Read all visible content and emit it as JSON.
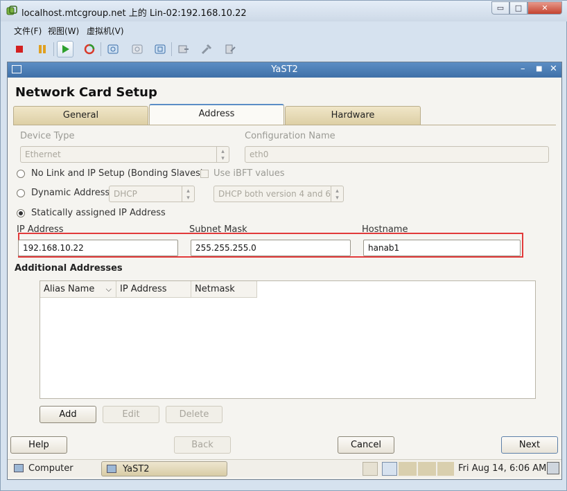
{
  "vm": {
    "title": "localhost.mtcgroup.net 上的 Lin-02:192.168.10.22",
    "menus": [
      "文件(F)",
      "视图(W)",
      "虚拟机(V)"
    ],
    "toolbar_icons": [
      "stop-icon",
      "pause-icon",
      "play-icon",
      "refresh-icon",
      "snapshot-icon",
      "snapshot-revert-icon",
      "snapshot-manager-icon",
      "migrate-icon",
      "tools-icon",
      "settings-icon"
    ],
    "window_controls": {
      "minimize": "▭",
      "maximize": "□",
      "close": "✕"
    }
  },
  "yast": {
    "window_title": "YaST2",
    "heading": "Network Card Setup",
    "tabs": [
      {
        "label": "General",
        "active": false
      },
      {
        "label": "Address",
        "active": true
      },
      {
        "label": "Hardware",
        "active": false
      }
    ],
    "device_type": {
      "label": "Device Type",
      "value": "Ethernet"
    },
    "config_name": {
      "label": "Configuration Name",
      "value": "eth0"
    },
    "radio_no_link": "No Link and IP Setup (Bonding Slaves)",
    "use_ibft": "Use iBFT values",
    "radio_dynamic": "Dynamic Address",
    "dhcp_mode": "DHCP",
    "dhcp_version": "DHCP both version 4 and 6",
    "radio_static": "Statically assigned IP Address",
    "ip_address": {
      "label": "IP Address",
      "value": "192.168.10.22"
    },
    "subnet_mask": {
      "label": "Subnet Mask",
      "value": "255.255.255.0"
    },
    "hostname": {
      "label": "Hostname",
      "value": "hanab1"
    },
    "additional_title": "Additional Addresses",
    "table_headers": [
      "Alias Name",
      "IP Address",
      "Netmask"
    ],
    "buttons": {
      "add": "Add",
      "edit": "Edit",
      "delete": "Delete",
      "help": "Help",
      "back": "Back",
      "cancel": "Cancel",
      "next": "Next"
    }
  },
  "taskbar": {
    "computer": "Computer",
    "task": "YaST2",
    "clock": "Fri Aug 14,  6:06 AM"
  },
  "colors": {
    "highlight": "#e23a3a",
    "titlebar": "#4a7db6"
  }
}
